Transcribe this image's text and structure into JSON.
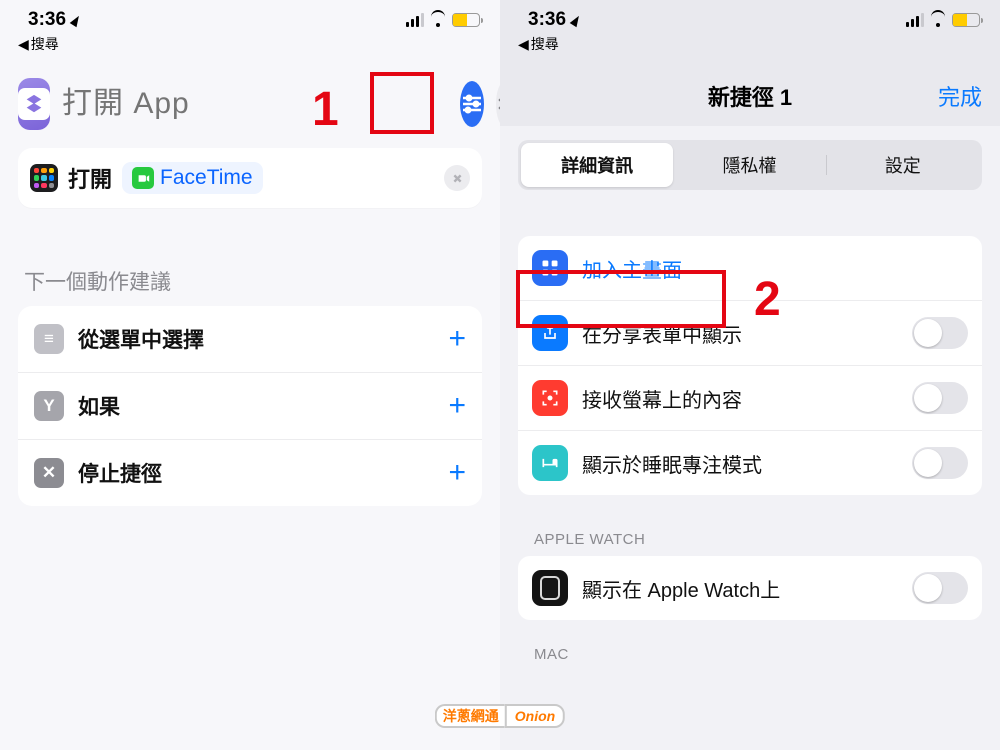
{
  "status": {
    "time": "3:36",
    "back_label": "搜尋"
  },
  "left": {
    "title_placeholder": "打開 App",
    "action": {
      "open_word": "打開",
      "target": "FaceTime"
    },
    "suggest_header": "下一個動作建議",
    "suggestions": [
      {
        "icon_bg": "#c0c0c6",
        "glyph": "≡",
        "label": "從選單中選擇"
      },
      {
        "icon_bg": "#a5a5ab",
        "glyph": "Y",
        "label": "如果"
      },
      {
        "icon_bg": "#8c8c92",
        "glyph": "✕",
        "label": "停止捷徑"
      }
    ],
    "marker": "1"
  },
  "right": {
    "title": "新捷徑 1",
    "done": "完成",
    "segments": [
      "詳細資訊",
      "隱私權",
      "設定"
    ],
    "rows": [
      {
        "icon_bg": "#2a6df4",
        "kind": "home",
        "label": "加入主畫面",
        "link": true,
        "toggle": false
      },
      {
        "icon_bg": "#0a7aff",
        "kind": "share",
        "label": "在分享表單中顯示",
        "link": false,
        "toggle": true
      },
      {
        "icon_bg": "#ff3b30",
        "kind": "screen",
        "label": "接收螢幕上的內容",
        "link": false,
        "toggle": true
      },
      {
        "icon_bg": "#2cc5c9",
        "kind": "sleep",
        "label": "顯示於睡眠專注模式",
        "link": false,
        "toggle": true
      }
    ],
    "group2_label": "APPLE WATCH",
    "watch_row_label": "顯示在 Apple Watch上",
    "group3_label": "MAC",
    "marker": "2"
  },
  "watermark": {
    "cn": "洋蔥網通",
    "en": "Onion"
  }
}
